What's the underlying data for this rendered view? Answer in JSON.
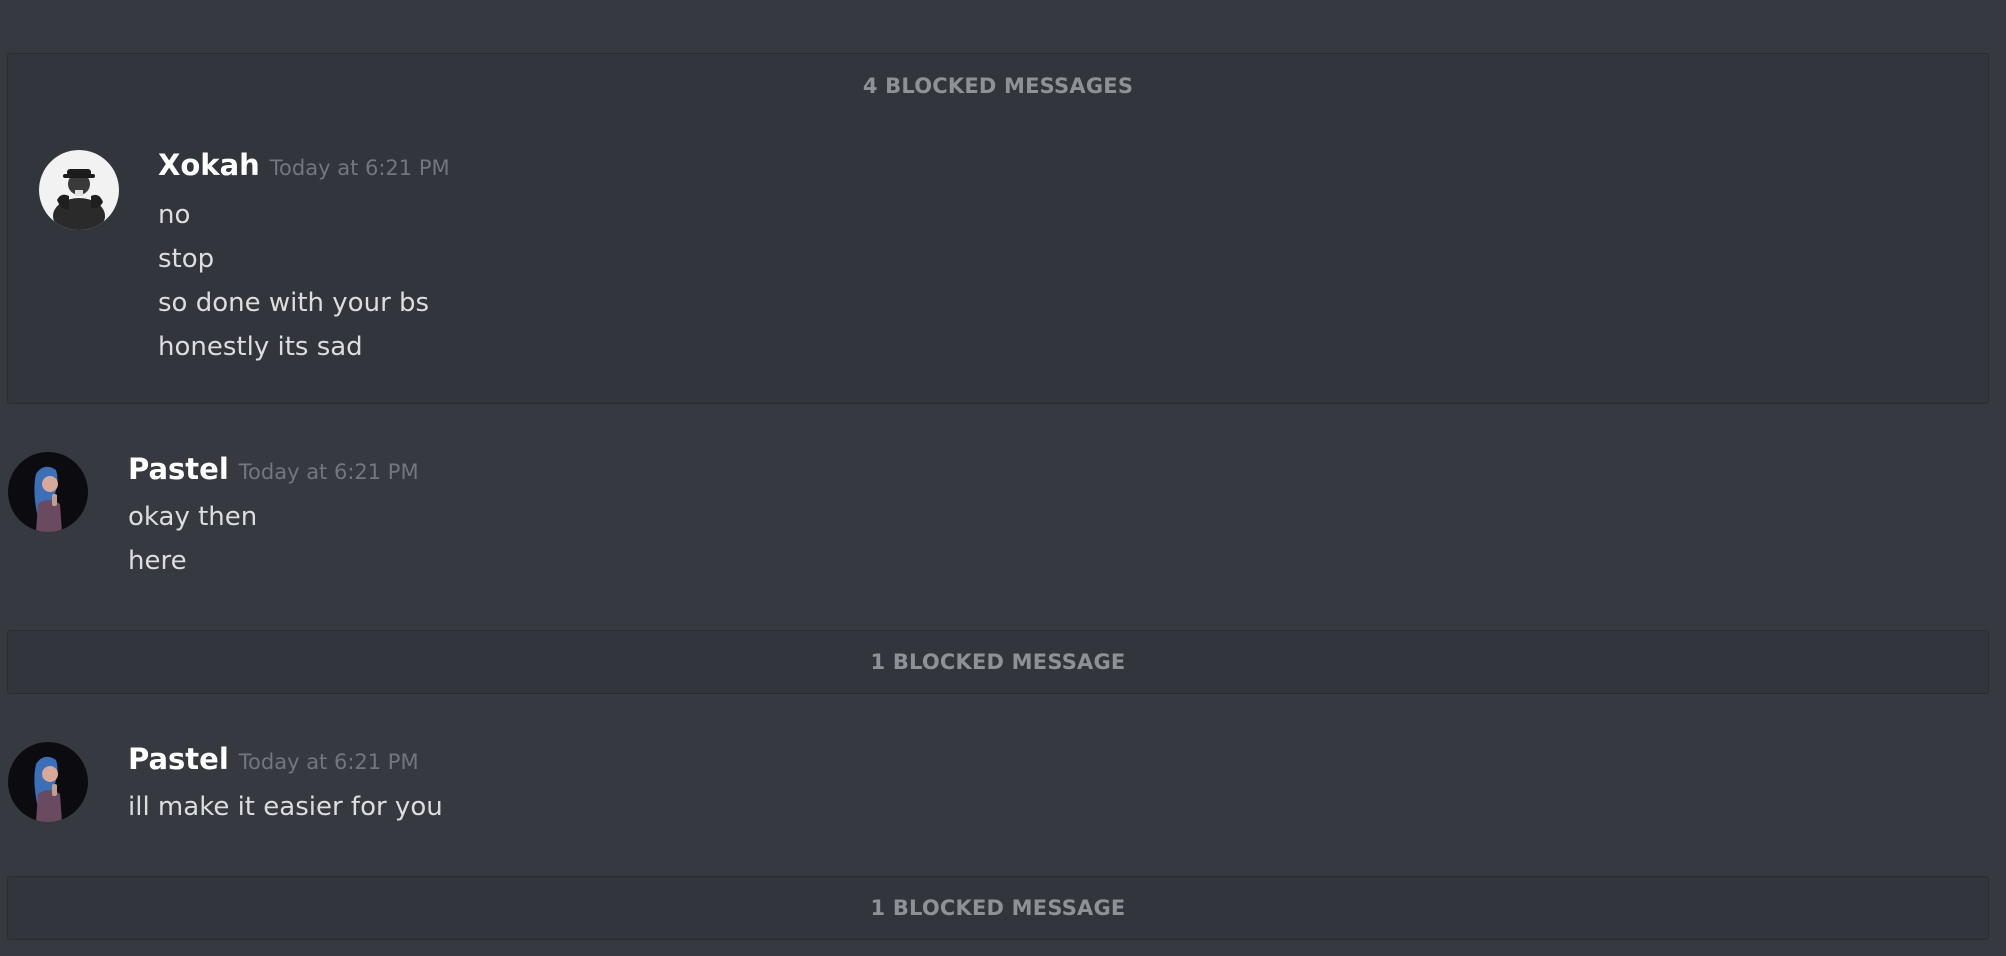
{
  "blocked_groups": [
    {
      "header": "4 BLOCKED MESSAGES",
      "message": {
        "username": "Xokah",
        "timestamp": "Today at 6:21 PM",
        "lines": [
          "no",
          "stop",
          "so done with your bs",
          "honestly its sad"
        ]
      }
    },
    {
      "header": "1 BLOCKED MESSAGE"
    },
    {
      "header": "1 BLOCKED MESSAGE"
    }
  ],
  "messages": [
    {
      "username": "Pastel",
      "timestamp": "Today at 6:21 PM",
      "lines": [
        "okay then",
        "here"
      ]
    },
    {
      "username": "Pastel",
      "timestamp": "Today at 6:21 PM",
      "lines": [
        "ill make it easier for you"
      ]
    }
  ],
  "colors": {
    "background": "#36393f",
    "blocked_background": "#32353b",
    "username": "#ffffff",
    "timestamp": "#72767d",
    "message_text": "#dcddde",
    "blocked_header": "#8e9297"
  }
}
